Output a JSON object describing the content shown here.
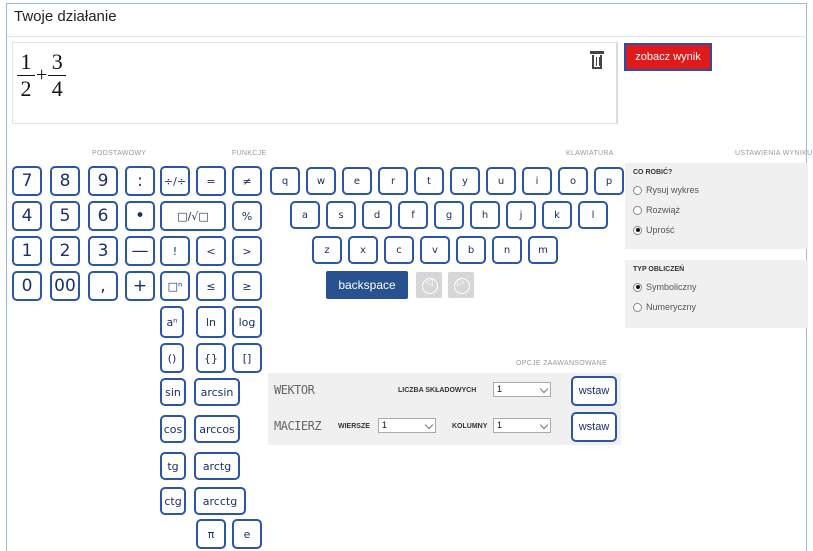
{
  "header": {
    "title": "Twoje działanie"
  },
  "expression": {
    "frac1": {
      "num": "1",
      "den": "2"
    },
    "operator": "+",
    "frac2": {
      "num": "3",
      "den": "4"
    }
  },
  "actions": {
    "show_result": "zobacz wynik"
  },
  "sections": {
    "basic": "PODSTAWOWY",
    "functions": "FUNKCJE",
    "keyboard": "KLAWIATURA",
    "result_settings": "USTAWIENIA WYNIKU",
    "advanced": "OPCJE ZAAWANSOWANE"
  },
  "basic_keys": [
    "7",
    "8",
    "9",
    ":",
    "4",
    "5",
    "6",
    "•",
    "1",
    "2",
    "3",
    "—",
    "0",
    "00",
    ",",
    "+"
  ],
  "function_keys_top": [
    "÷/÷",
    "=",
    "≠",
    "□/√□",
    "%",
    "!",
    "<",
    ">",
    "□ⁿ",
    "≤",
    "≥"
  ],
  "function_keys_bottom": [
    "aⁿ",
    "ln",
    "log",
    "()",
    "{}",
    "[]",
    "sin",
    "arcsin",
    "cos",
    "arccos",
    "tg",
    "arctg",
    "ctg",
    "arcctg",
    "π",
    "e"
  ],
  "keyboard_rows": [
    [
      "q",
      "w",
      "e",
      "r",
      "t",
      "y",
      "u",
      "i",
      "o",
      "p"
    ],
    [
      "a",
      "s",
      "d",
      "f",
      "g",
      "h",
      "j",
      "k",
      "l"
    ],
    [
      "z",
      "x",
      "c",
      "v",
      "b",
      "n",
      "m"
    ]
  ],
  "keyboard": {
    "backspace": "backspace",
    "arrow_left": "◁",
    "arrow_right": "▷"
  },
  "advanced": {
    "vector": {
      "name": "WEKTOR",
      "components_label": "LICZBA SKŁADOWYCH",
      "components_value": "1",
      "insert": "wstaw"
    },
    "matrix": {
      "name": "MACIERZ",
      "rows_label": "WIERSZE",
      "rows_value": "1",
      "cols_label": "KOLUMNY",
      "cols_value": "1",
      "insert": "wstaw"
    }
  },
  "settings": {
    "what_to_do": {
      "title": "CO ROBIĆ?",
      "options": [
        "Rysuj wykres",
        "Rozwiąż",
        "Uprość"
      ],
      "selected_index": 2
    },
    "calc_type": {
      "title": "TYP OBLICZEŃ",
      "options": [
        "Symboliczny",
        "Numeryczny"
      ],
      "selected_index": 0
    }
  },
  "colors": {
    "accent_blue": "#2b55a8",
    "dark_button": "#27528f",
    "result_button": "#e01a1a"
  }
}
